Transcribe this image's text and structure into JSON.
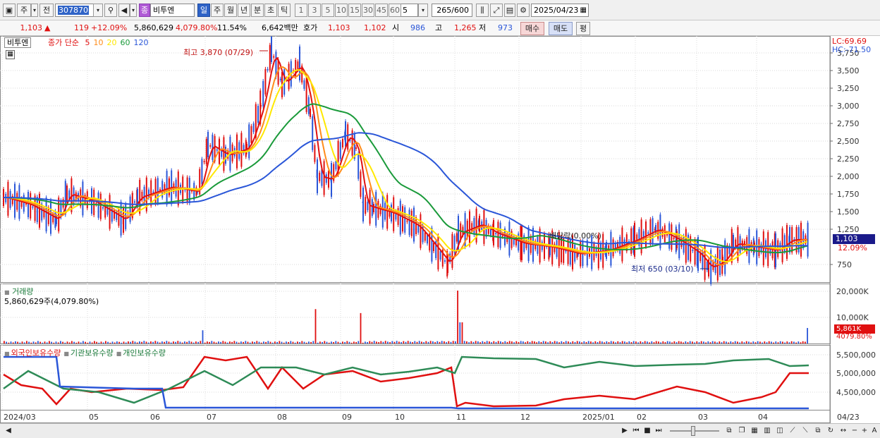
{
  "toolbar": {
    "period_buttons": [
      {
        "label": "주"
      },
      {
        "label": "전"
      }
    ],
    "code": "307870",
    "type_badge": "종",
    "stock_name": "비투엔",
    "interval_tabs": [
      "일",
      "주",
      "월",
      "년",
      "분",
      "초",
      "틱"
    ],
    "active_interval": "일",
    "minute_buttons": [
      "1",
      "3",
      "5",
      "10",
      "15",
      "30",
      "45",
      "60"
    ],
    "minute_value": "5",
    "count_display": "265/600",
    "date": "2025/04/23"
  },
  "quote": {
    "price": "1,103",
    "change": "119",
    "change_pct": "+12.09%",
    "volume": "5,860,629",
    "volume_pct": "4,079.80%",
    "turnover": "11.54%",
    "amount": "6,642백만",
    "bid_label": "호가",
    "ask_price": "1,103",
    "bid_price": "1,102",
    "open_label": "시",
    "open": "986",
    "high_label": "고",
    "high": "1,265",
    "low_label": "저",
    "low": "973",
    "buy_button": "매수",
    "sell_button": "매도",
    "eval_button": "평"
  },
  "chart": {
    "name_tag": "비투엔",
    "legend_prefix": "종가 단순",
    "ma": [
      {
        "period": "5",
        "color": "#e01010"
      },
      {
        "period": "10",
        "color": "#ff8c1a"
      },
      {
        "period": "20",
        "color": "#ffe800"
      },
      {
        "period": "60",
        "color": "#1a9a3a"
      },
      {
        "period": "120",
        "color": "#2a56d8"
      }
    ],
    "lc_label": "LC:69.69",
    "hc_label": "HC:-71.50",
    "high_annotation": "최고 3,870 (07/29)",
    "low_annotation": "최저 650 (03/10)",
    "mid_annotation": "배당락(0.00%)",
    "price_ticks": [
      "3,750",
      "3,500",
      "3,250",
      "3,000",
      "2,750",
      "2,500",
      "2,250",
      "2,000",
      "1,750",
      "1,500",
      "1,250",
      "750"
    ],
    "current_price_label": "1,103",
    "current_pct_label": "12.09%"
  },
  "volume_panel": {
    "title": "거래량",
    "value_text": "5,860,629주(4,079.80%)",
    "ticks": [
      "20,000K",
      "10,000K"
    ],
    "current_label": "5,861K",
    "current_pct": "4079.80%"
  },
  "holding_panel": {
    "legend": [
      "외국인보유수량",
      "기관보유수량",
      "개인보유수량"
    ],
    "ticks": [
      "5,500,000",
      "5,000,000",
      "4,500,000"
    ]
  },
  "x_axis": {
    "labels": [
      "2024/03",
      "05",
      "06",
      "07",
      "08",
      "09",
      "10",
      "11",
      "12",
      "2025/01",
      "02",
      "03",
      "04"
    ],
    "end_label": "04/23"
  },
  "colors": {
    "up": "#e01010",
    "down": "#2a56d8",
    "accent": "#2f63c7"
  }
}
